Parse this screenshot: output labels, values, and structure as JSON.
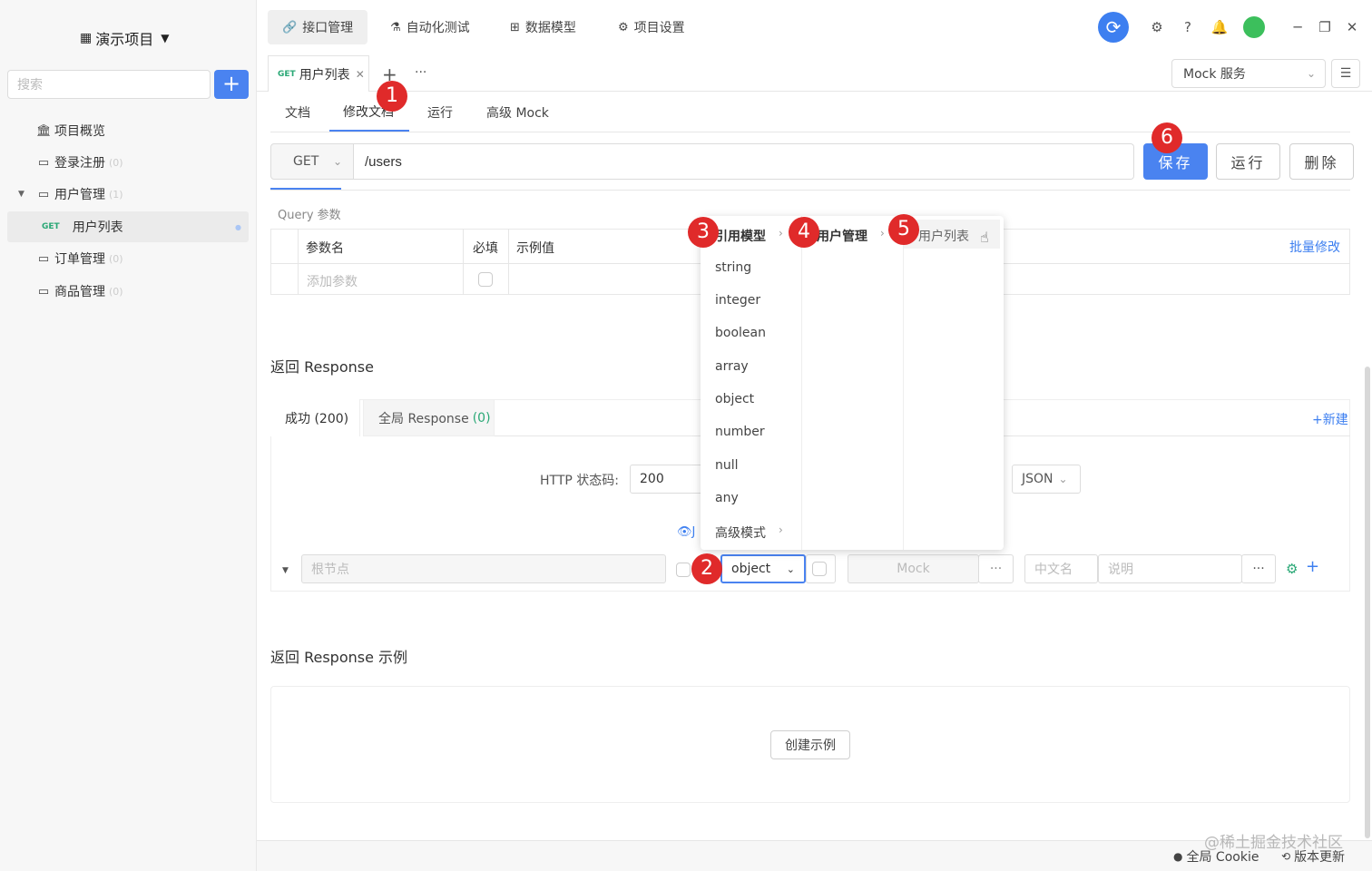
{
  "sidebar": {
    "project_title": "演示项目",
    "search_placeholder": "搜索",
    "add_label": "+",
    "items": [
      {
        "label": "项目概览",
        "count": ""
      },
      {
        "label": "登录注册",
        "count": "(0)"
      },
      {
        "label": "用户管理",
        "count": "(1)"
      },
      {
        "label": "用户列表",
        "method": "GET",
        "count": ""
      },
      {
        "label": "订单管理",
        "count": "(0)"
      },
      {
        "label": "商品管理",
        "count": "(0)"
      }
    ]
  },
  "topnav": {
    "tabs": [
      "接口管理",
      "自动化测试",
      "数据模型",
      "项目设置"
    ]
  },
  "doc_tab": {
    "method": "GET",
    "label": "用户列表"
  },
  "mock_service": "Mock 服务",
  "sub_tabs": [
    "文档",
    "修改文档",
    "运行",
    "高级 Mock"
  ],
  "request": {
    "method": "GET",
    "url": "/users",
    "save": "保存",
    "run": "运行",
    "delete": "删除"
  },
  "query": {
    "title": "Query 参数",
    "headers": [
      "参数名",
      "必填",
      "示例值"
    ],
    "add_placeholder": "添加参数",
    "batch_edit": "批量修改"
  },
  "response": {
    "title": "返回 Response",
    "tab_success": "成功 (200)",
    "tab_global": "全局 Response",
    "tab_global_count": "(0)",
    "new": "+新建",
    "status_label": "HTTP 状态码:",
    "status_value": "200",
    "format": "JSON",
    "schema_link": "J",
    "root_placeholder": "根节点",
    "type_value": "object",
    "mock_placeholder": "Mock",
    "cn_placeholder": "中文名",
    "desc_placeholder": "说明",
    "more": "···"
  },
  "example": {
    "title": "返回 Response 示例",
    "create": "创建示例"
  },
  "dropdown": {
    "col1_header": "引用模型",
    "col2_header": "用户管理",
    "col3_header": "用户列表",
    "types": [
      "string",
      "integer",
      "boolean",
      "array",
      "object",
      "number",
      "null",
      "any",
      "高级模式"
    ]
  },
  "markers": [
    "1",
    "2",
    "3",
    "4",
    "5",
    "6"
  ],
  "footer": {
    "watermark": "@稀土掘金技术社区",
    "cookie": "全局 Cookie",
    "update": "版本更新"
  },
  "colors": {
    "primary": "#4a83f0",
    "marker": "#e02a2a",
    "get": "#2aa876"
  }
}
